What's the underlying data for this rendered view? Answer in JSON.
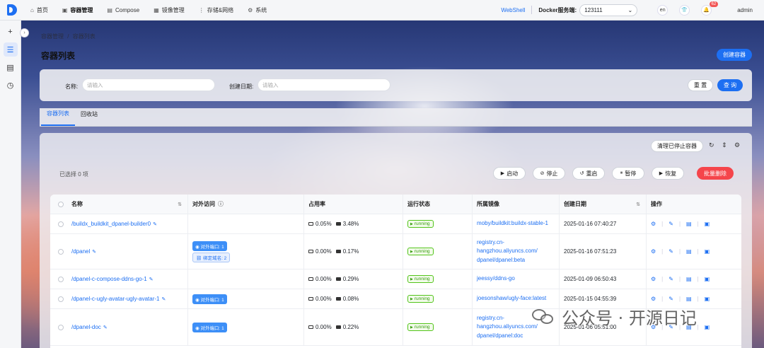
{
  "topbar": {
    "nav": [
      {
        "label": "首页",
        "icon": "home-icon",
        "glyph": "⌂",
        "active": false
      },
      {
        "label": "容器管理",
        "icon": "container-icon",
        "glyph": "▣",
        "active": true
      },
      {
        "label": "Compose",
        "icon": "compose-icon",
        "glyph": "▤",
        "active": false
      },
      {
        "label": "镜像管理",
        "icon": "image-icon",
        "glyph": "▦",
        "active": false
      },
      {
        "label": "存储&网络",
        "icon": "storage-icon",
        "glyph": "⋮",
        "active": false
      },
      {
        "label": "系统",
        "icon": "system-gear-icon",
        "glyph": "⚙",
        "active": false
      }
    ],
    "webshell": "WebShell",
    "docker_label": "Docker服务端:",
    "docker_value": "123111",
    "lang": "en",
    "notification_count": "62",
    "user": "admin"
  },
  "breadcrumb": {
    "parent": "容器管理",
    "separator": "/",
    "current": "容器列表"
  },
  "page_title": "容器列表",
  "create_button": "创建容器",
  "search": {
    "name_label": "名称:",
    "name_placeholder": "请输入",
    "date_label": "创建日期:",
    "date_placeholder": "请输入",
    "reset": "重 置",
    "query": "查 询"
  },
  "tabs": [
    {
      "label": "容器列表",
      "active": true
    },
    {
      "label": "回收站",
      "active": false
    }
  ],
  "toolbar": {
    "clean_stopped": "清理已停止容器",
    "selected_text": "已选择  0  项",
    "start": "启动",
    "stop": "停止",
    "restart": "重启",
    "pause": "暂停",
    "resume": "恢复",
    "batch_delete": "批量删除"
  },
  "table": {
    "headers": {
      "name": "名称",
      "port": "对外访问",
      "usage": "占用率",
      "state": "运行状态",
      "image": "所属镜像",
      "date": "创建日期",
      "ops": "操作"
    },
    "rows": [
      {
        "name": "/buildx_buildkit_dpanel-builder0",
        "ports": [],
        "domains": [],
        "cpu": "0.05%",
        "mem": "3.48%",
        "state": "running",
        "image": [
          "moby/buildkit:buildx-stable-1"
        ],
        "date": "2025-01-16 07:40:27"
      },
      {
        "name": "/dpanel",
        "ports": [
          "对外端口: 1"
        ],
        "domains": [
          "绑定域名: 2"
        ],
        "cpu": "0.00%",
        "mem": "0.17%",
        "state": "running",
        "image": [
          "registry.cn-",
          "hangzhou.aliyuncs.com/",
          "dpanel/dpanel:beta"
        ],
        "date": "2025-01-16 07:51:23"
      },
      {
        "name": "/dpanel-c-compose-ddns-go-1",
        "ports": [],
        "domains": [],
        "cpu": "0.00%",
        "mem": "0.29%",
        "state": "running",
        "image": [
          "jeessy/ddns-go"
        ],
        "date": "2025-01-09 06:50:43"
      },
      {
        "name": "/dpanel-c-ugly-avatar-ugly-avatar-1",
        "ports": [
          "对外端口: 1"
        ],
        "domains": [],
        "cpu": "0.00%",
        "mem": "0.08%",
        "state": "running",
        "image": [
          "joesonshaw/ugly-face:latest"
        ],
        "date": "2025-01-15 04:55:39"
      },
      {
        "name": "/dpanel-doc",
        "ports": [
          "对外端口: 1"
        ],
        "domains": [],
        "cpu": "0.00%",
        "mem": "0.22%",
        "state": "running",
        "image": [
          "registry.cn-",
          "hangzhou.aliyuncs.com/",
          "dpanel/dpanel:doc"
        ],
        "date": "2025-01-06 05:51:00"
      }
    ]
  },
  "watermark": {
    "text": "公众号 · 开源日记"
  }
}
